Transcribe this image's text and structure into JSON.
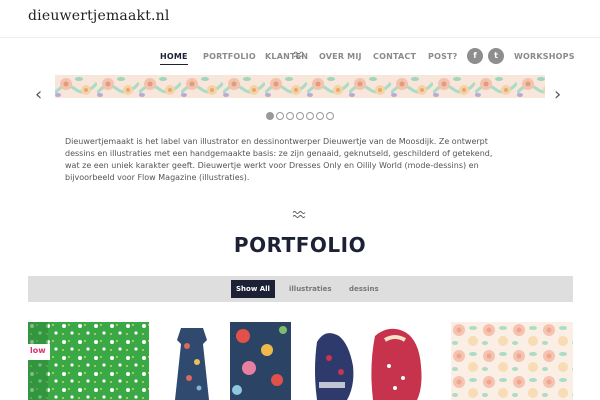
{
  "site": {
    "logo": "dieuwertjemaakt.nl"
  },
  "nav": {
    "items": [
      {
        "label": "HOME",
        "active": true
      },
      {
        "label": "PORTFOLIO"
      },
      {
        "label": "KLANTEN"
      },
      {
        "label": "OVER MIJ"
      },
      {
        "label": "CONTACT"
      },
      {
        "label": "POST?"
      },
      {
        "label": "WORKSHOPS"
      }
    ],
    "social": [
      {
        "icon": "facebook-icon",
        "glyph": "f"
      },
      {
        "icon": "twitter-icon",
        "glyph": "t"
      }
    ]
  },
  "slider": {
    "prev_glyph": "‹",
    "next_glyph": "›",
    "dot_count": 7,
    "active_dot": 0
  },
  "intro": {
    "text": "Dieuwertjemaakt is het label van illustrator en dessinontwerper Dieuwertje van de Moosdijk. Ze ontwerpt dessins en illustraties met een handgemaakte basis: ze zijn genaaid, geknutseld, geschilderd of getekend, wat ze een uniek karakter geeft. Dieuwertje werkt voor Dresses Only en Oilily World (mode-dessins) en bijvoorbeeld voor Flow Magazine (illustraties)."
  },
  "portfolio": {
    "title": "PORTFOLIO",
    "filters": [
      {
        "label": "Show All",
        "active": true
      },
      {
        "label": "illustraties"
      },
      {
        "label": "dessins"
      }
    ],
    "thumbnail_badge": "low"
  },
  "colors": {
    "navy": "#1d2136",
    "pattern_pink": "#f2c4b0",
    "pattern_mint": "#a8dcc6",
    "green_print": "#39a845",
    "filter_bar": "#dedede"
  }
}
